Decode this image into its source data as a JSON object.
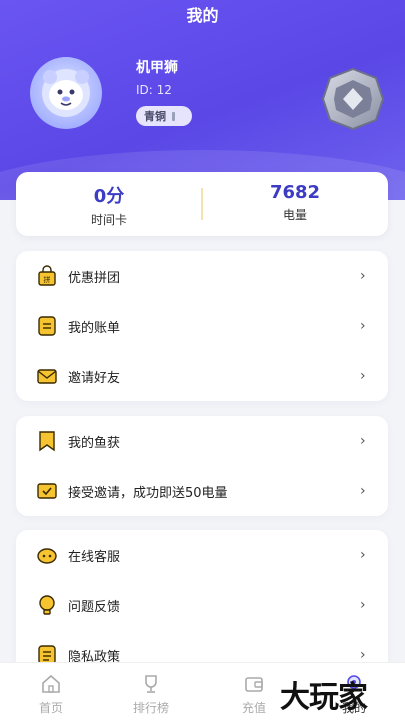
{
  "header": {
    "title": "我的"
  },
  "profile": {
    "name": "机甲狮",
    "id_text": "ID: 12",
    "rank": "青铜"
  },
  "stats": [
    {
      "value": "0分",
      "label": "时间卡"
    },
    {
      "value": "7682",
      "label": "电量"
    }
  ],
  "menu_groups": [
    {
      "items": [
        {
          "label": "优惠拼团",
          "icon": "group-buy-bag-icon"
        },
        {
          "label": "我的账单",
          "icon": "bill-icon"
        },
        {
          "label": "邀请好友",
          "icon": "envelope-icon"
        }
      ]
    },
    {
      "items": [
        {
          "label": "我的鱼获",
          "icon": "bookmark-icon"
        },
        {
          "label": "接受邀请，成功即送50电量",
          "icon": "accept-invite-icon"
        }
      ]
    },
    {
      "items": [
        {
          "label": "在线客服",
          "icon": "customer-service-icon"
        },
        {
          "label": "问题反馈",
          "icon": "feedback-icon"
        },
        {
          "label": "隐私政策",
          "icon": "privacy-icon"
        }
      ]
    }
  ],
  "tabbar": [
    {
      "label": "首页",
      "icon": "home-icon"
    },
    {
      "label": "排行榜",
      "icon": "trophy-icon"
    },
    {
      "label": "充值",
      "icon": "wallet-icon"
    },
    {
      "label": "我的",
      "icon": "profile-icon"
    }
  ],
  "watermark": "大玩家",
  "colors": {
    "accent": "#5b48e8",
    "stat_value": "#3c3cc4",
    "icon_yellow": "#f5c430"
  }
}
